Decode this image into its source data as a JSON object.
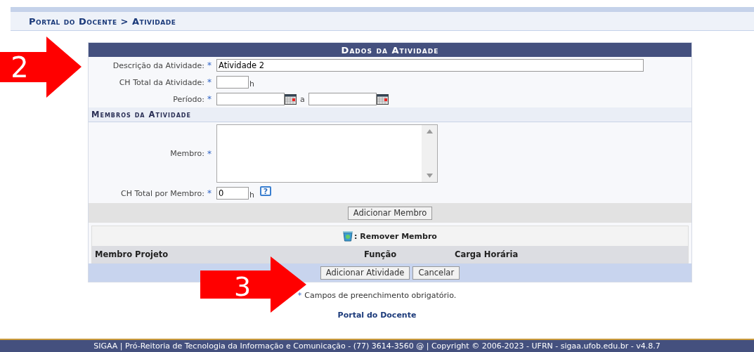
{
  "breadcrumb": "Portal do Docente > Atividade",
  "form": {
    "title": "Dados da Atividade",
    "fields": [
      {
        "kind": "text",
        "label": "Descrição da Atividade:",
        "value": "Atividade 2"
      },
      {
        "kind": "hours",
        "label": "CH Total da Atividade:",
        "unit": "h"
      },
      {
        "kind": "period",
        "label": "Período:",
        "separator": "a"
      }
    ],
    "section": "Membros da Atividade",
    "member_fields": [
      {
        "kind": "list",
        "label": "Membro:"
      },
      {
        "kind": "hours",
        "label": "CH Total por Membro:",
        "value": "0",
        "unit": "h",
        "help": "?"
      }
    ],
    "add_member_button": "Adicionar Membro",
    "legend": ": Remover Membro",
    "columns": [
      "Membro Projeto",
      "Função",
      "Carga Horária"
    ],
    "buttons": [
      "Adicionar Atividade",
      "Cancelar"
    ]
  },
  "required_star": "*",
  "required_note": "Campos de preenchimento obrigatório.",
  "footer_link": "Portal do Docente",
  "footer": "SIGAA | Pró-Reitoria de Tecnologia da Informação e Comunicação - (77) 3614-3560 @ | Copyright © 2006-2023 - UFRN - sigaa.ufob.edu.br - v4.8.7",
  "annotations": [
    {
      "label": "2"
    },
    {
      "label": "3"
    }
  ]
}
